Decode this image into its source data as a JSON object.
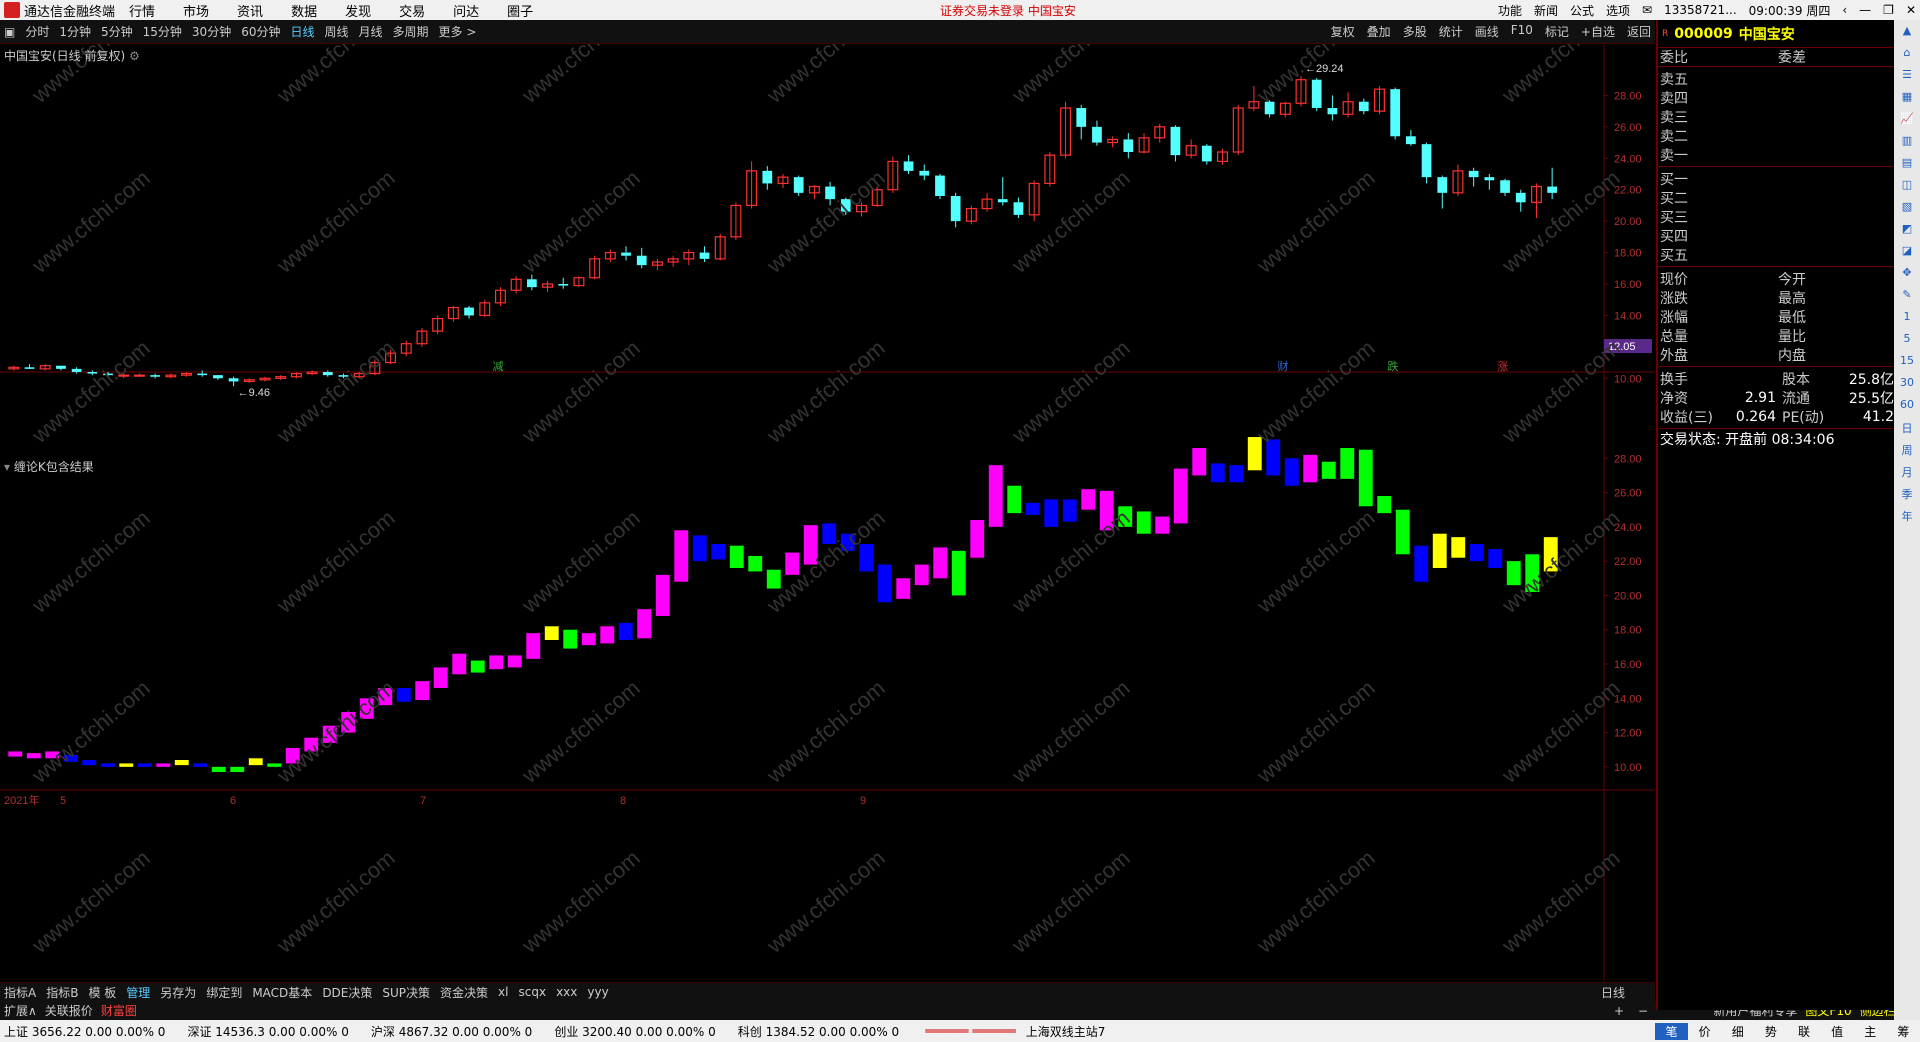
{
  "titlebar": {
    "app": "通达信金融终端",
    "menu": [
      "行情",
      "市场",
      "资讯",
      "数据",
      "发现",
      "交易",
      "问达",
      "圈子"
    ],
    "warning": "证券交易未登录   中国宝安",
    "right": [
      "功能",
      "新闻",
      "公式",
      "选项",
      "13358721...",
      "09:00:39 周四"
    ]
  },
  "periods": [
    "分时",
    "1分钟",
    "5分钟",
    "15分钟",
    "30分钟",
    "60分钟",
    "日线",
    "周线",
    "月线",
    "多周期",
    "更多 >"
  ],
  "active_period": "日线",
  "tools": [
    "复权",
    "叠加",
    "多股",
    "统计",
    "画线",
    "F10",
    "标记",
    "+自选",
    "返回"
  ],
  "chart": {
    "title": "中国宝安(日线 前复权)",
    "sub_title": "缠论K包含结果",
    "price_label": "12.05",
    "max_label": "29.24",
    "min_label": "9.46",
    "date_labels": [
      "2021年",
      "5",
      "6",
      "7",
      "8",
      "9"
    ],
    "flags": [
      {
        "t": "减"
      },
      {
        "t": "财"
      },
      {
        "t": "跌"
      },
      {
        "t": "涨"
      }
    ],
    "watermark": "www.cfchi.com"
  },
  "chart_data": [
    {
      "type": "candlestick",
      "title": "中国宝安(日线 前复权)",
      "ylim": [
        9,
        30
      ],
      "yticks": [
        10,
        12,
        14,
        16,
        18,
        20,
        22,
        24,
        26,
        28
      ],
      "ohlc": [
        [
          10.6,
          10.8,
          10.5,
          10.7
        ],
        [
          10.7,
          10.9,
          10.6,
          10.6
        ],
        [
          10.6,
          10.9,
          10.5,
          10.8
        ],
        [
          10.8,
          10.8,
          10.5,
          10.6
        ],
        [
          10.6,
          10.7,
          10.3,
          10.4
        ],
        [
          10.4,
          10.5,
          10.2,
          10.3
        ],
        [
          10.3,
          10.4,
          10.1,
          10.2
        ],
        [
          10.2,
          10.3,
          10.0,
          10.2
        ],
        [
          10.2,
          10.3,
          10.1,
          10.2
        ],
        [
          10.2,
          10.3,
          10.0,
          10.1
        ],
        [
          10.1,
          10.3,
          10.0,
          10.2
        ],
        [
          10.2,
          10.4,
          10.1,
          10.3
        ],
        [
          10.3,
          10.5,
          10.1,
          10.2
        ],
        [
          10.2,
          10.2,
          9.9,
          10.0
        ],
        [
          10.0,
          10.1,
          9.5,
          9.8
        ],
        [
          9.8,
          10.0,
          9.7,
          9.9
        ],
        [
          9.9,
          10.1,
          9.8,
          10.0
        ],
        [
          10.0,
          10.2,
          9.9,
          10.1
        ],
        [
          10.1,
          10.4,
          10.0,
          10.3
        ],
        [
          10.3,
          10.5,
          10.2,
          10.4
        ],
        [
          10.4,
          10.5,
          10.1,
          10.2
        ],
        [
          10.2,
          10.3,
          10.0,
          10.1
        ],
        [
          10.1,
          10.4,
          10.0,
          10.3
        ],
        [
          10.3,
          11.2,
          10.2,
          11.0
        ],
        [
          11.0,
          11.8,
          10.9,
          11.6
        ],
        [
          11.6,
          12.4,
          11.4,
          12.2
        ],
        [
          12.2,
          13.2,
          12.0,
          13.0
        ],
        [
          13.0,
          14.0,
          12.8,
          13.8
        ],
        [
          13.8,
          14.6,
          13.6,
          14.5
        ],
        [
          14.5,
          14.6,
          13.8,
          14.0
        ],
        [
          14.0,
          15.0,
          13.9,
          14.8
        ],
        [
          14.8,
          15.8,
          14.6,
          15.6
        ],
        [
          15.6,
          16.5,
          15.4,
          16.3
        ],
        [
          16.3,
          16.6,
          15.6,
          15.8
        ],
        [
          15.8,
          16.2,
          15.5,
          16.0
        ],
        [
          16.0,
          16.4,
          15.7,
          15.9
        ],
        [
          15.9,
          16.5,
          15.8,
          16.4
        ],
        [
          16.4,
          17.8,
          16.3,
          17.6
        ],
        [
          17.6,
          18.2,
          17.4,
          18.0
        ],
        [
          18.0,
          18.4,
          17.5,
          17.8
        ],
        [
          17.8,
          18.3,
          17.0,
          17.2
        ],
        [
          17.2,
          17.6,
          16.9,
          17.4
        ],
        [
          17.4,
          17.8,
          17.1,
          17.6
        ],
        [
          17.6,
          18.2,
          17.2,
          18.0
        ],
        [
          18.0,
          18.4,
          17.4,
          17.6
        ],
        [
          17.6,
          19.2,
          17.5,
          19.0
        ],
        [
          19.0,
          21.2,
          18.8,
          21.0
        ],
        [
          21.0,
          23.8,
          20.8,
          23.2
        ],
        [
          23.2,
          23.5,
          22.0,
          22.4
        ],
        [
          22.4,
          23.0,
          22.1,
          22.8
        ],
        [
          22.8,
          22.9,
          21.6,
          21.8
        ],
        [
          21.8,
          22.3,
          21.4,
          22.2
        ],
        [
          22.2,
          22.5,
          21.0,
          21.4
        ],
        [
          21.4,
          21.5,
          20.4,
          20.6
        ],
        [
          20.6,
          21.2,
          20.3,
          21.0
        ],
        [
          21.0,
          22.2,
          20.9,
          22.0
        ],
        [
          22.0,
          24.1,
          21.8,
          23.8
        ],
        [
          23.8,
          24.2,
          23.0,
          23.2
        ],
        [
          23.2,
          23.6,
          22.6,
          22.9
        ],
        [
          22.9,
          23.0,
          21.4,
          21.6
        ],
        [
          21.6,
          21.8,
          19.6,
          20.0
        ],
        [
          20.0,
          21.0,
          19.8,
          20.8
        ],
        [
          20.8,
          21.8,
          20.6,
          21.4
        ],
        [
          21.4,
          22.8,
          21.0,
          21.2
        ],
        [
          21.2,
          21.5,
          20.2,
          20.4
        ],
        [
          20.4,
          22.6,
          20.0,
          22.4
        ],
        [
          22.4,
          24.4,
          22.2,
          24.2
        ],
        [
          24.2,
          27.6,
          24.0,
          27.2
        ],
        [
          27.2,
          27.4,
          25.2,
          26.0
        ],
        [
          26.0,
          26.4,
          24.8,
          25.0
        ],
        [
          25.0,
          25.4,
          24.7,
          25.2
        ],
        [
          25.2,
          25.6,
          24.0,
          24.4
        ],
        [
          24.4,
          25.6,
          24.3,
          25.3
        ],
        [
          25.3,
          26.2,
          25.0,
          26.0
        ],
        [
          26.0,
          26.1,
          23.8,
          24.2
        ],
        [
          24.2,
          25.2,
          24.0,
          24.8
        ],
        [
          24.8,
          24.9,
          23.6,
          23.8
        ],
        [
          23.8,
          24.6,
          23.6,
          24.4
        ],
        [
          24.4,
          27.4,
          24.2,
          27.2
        ],
        [
          27.2,
          28.6,
          27.0,
          27.6
        ],
        [
          27.6,
          27.7,
          26.6,
          26.8
        ],
        [
          26.8,
          27.6,
          26.6,
          27.5
        ],
        [
          27.5,
          29.24,
          27.3,
          29.0
        ],
        [
          29.0,
          29.1,
          27.0,
          27.2
        ],
        [
          27.2,
          28.0,
          26.4,
          26.8
        ],
        [
          26.8,
          28.2,
          26.6,
          27.6
        ],
        [
          27.6,
          27.8,
          26.8,
          27.0
        ],
        [
          27.0,
          28.6,
          26.8,
          28.4
        ],
        [
          28.4,
          28.5,
          25.2,
          25.4
        ],
        [
          25.4,
          25.8,
          24.8,
          24.9
        ],
        [
          24.9,
          25.0,
          22.4,
          22.8
        ],
        [
          22.8,
          22.9,
          20.8,
          21.8
        ],
        [
          21.8,
          23.6,
          21.6,
          23.2
        ],
        [
          23.2,
          23.4,
          22.2,
          22.8
        ],
        [
          22.8,
          23.0,
          22.0,
          22.6
        ],
        [
          22.6,
          22.7,
          21.6,
          21.8
        ],
        [
          21.8,
          22.0,
          20.6,
          21.2
        ],
        [
          21.2,
          22.4,
          20.2,
          22.2
        ],
        [
          22.2,
          23.4,
          21.4,
          21.8
        ]
      ]
    },
    {
      "type": "bar",
      "title": "缠论K包含结果",
      "note": "merged K (包含关系) bars",
      "ylim": [
        9,
        30
      ],
      "bars": [
        [
          10.6,
          10.9,
          "m"
        ],
        [
          10.5,
          10.8,
          "m"
        ],
        [
          10.5,
          10.9,
          "m"
        ],
        [
          10.3,
          10.7,
          "b"
        ],
        [
          10.1,
          10.4,
          "b"
        ],
        [
          10.0,
          10.2,
          "b"
        ],
        [
          10.0,
          10.2,
          "y"
        ],
        [
          10.0,
          10.2,
          "b"
        ],
        [
          10.0,
          10.2,
          "m"
        ],
        [
          10.1,
          10.4,
          "y"
        ],
        [
          10.0,
          10.2,
          "b"
        ],
        [
          9.7,
          10.0,
          "g"
        ],
        [
          9.7,
          10.0,
          "g"
        ],
        [
          10.1,
          10.5,
          "y"
        ],
        [
          10.0,
          10.2,
          "g"
        ],
        [
          10.2,
          11.1,
          "m"
        ],
        [
          10.9,
          11.7,
          "m"
        ],
        [
          11.4,
          12.4,
          "m"
        ],
        [
          12.0,
          13.2,
          "m"
        ],
        [
          12.8,
          14.0,
          "m"
        ],
        [
          13.6,
          14.6,
          "m"
        ],
        [
          13.8,
          14.6,
          "b"
        ],
        [
          13.9,
          15.0,
          "m"
        ],
        [
          14.6,
          15.8,
          "m"
        ],
        [
          15.4,
          16.6,
          "m"
        ],
        [
          15.5,
          16.2,
          "g"
        ],
        [
          15.7,
          16.5,
          "m"
        ],
        [
          15.8,
          16.5,
          "m"
        ],
        [
          16.3,
          17.8,
          "m"
        ],
        [
          17.4,
          18.2,
          "y"
        ],
        [
          16.9,
          18.0,
          "g"
        ],
        [
          17.1,
          17.8,
          "m"
        ],
        [
          17.2,
          18.2,
          "m"
        ],
        [
          17.4,
          18.4,
          "b"
        ],
        [
          17.5,
          19.2,
          "m"
        ],
        [
          18.8,
          21.2,
          "m"
        ],
        [
          20.8,
          23.8,
          "m"
        ],
        [
          22.0,
          23.5,
          "b"
        ],
        [
          22.1,
          23.0,
          "b"
        ],
        [
          21.6,
          22.9,
          "g"
        ],
        [
          21.4,
          22.3,
          "g"
        ],
        [
          20.4,
          21.5,
          "g"
        ],
        [
          21.2,
          22.5,
          "m"
        ],
        [
          21.8,
          24.1,
          "m"
        ],
        [
          23.0,
          24.2,
          "b"
        ],
        [
          22.6,
          23.6,
          "b"
        ],
        [
          21.4,
          23.0,
          "b"
        ],
        [
          19.6,
          21.8,
          "b"
        ],
        [
          19.8,
          21.0,
          "m"
        ],
        [
          20.6,
          21.8,
          "m"
        ],
        [
          21.0,
          22.8,
          "m"
        ],
        [
          20.0,
          22.6,
          "g"
        ],
        [
          22.2,
          24.4,
          "m"
        ],
        [
          24.0,
          27.6,
          "m"
        ],
        [
          24.8,
          26.4,
          "g"
        ],
        [
          24.7,
          25.4,
          "b"
        ],
        [
          24.0,
          25.6,
          "b"
        ],
        [
          24.3,
          25.6,
          "b"
        ],
        [
          25.0,
          26.2,
          "m"
        ],
        [
          23.8,
          26.1,
          "m"
        ],
        [
          24.0,
          25.2,
          "g"
        ],
        [
          23.6,
          24.9,
          "g"
        ],
        [
          23.6,
          24.6,
          "m"
        ],
        [
          24.2,
          27.4,
          "m"
        ],
        [
          27.0,
          28.6,
          "m"
        ],
        [
          26.6,
          27.7,
          "b"
        ],
        [
          26.6,
          27.6,
          "b"
        ],
        [
          27.3,
          29.24,
          "y"
        ],
        [
          27.0,
          29.1,
          "b"
        ],
        [
          26.4,
          28.0,
          "b"
        ],
        [
          26.6,
          28.2,
          "m"
        ],
        [
          26.8,
          27.8,
          "g"
        ],
        [
          26.8,
          28.6,
          "g"
        ],
        [
          25.2,
          28.5,
          "g"
        ],
        [
          24.8,
          25.8,
          "g"
        ],
        [
          22.4,
          25.0,
          "g"
        ],
        [
          20.8,
          22.9,
          "b"
        ],
        [
          21.6,
          23.6,
          "y"
        ],
        [
          22.2,
          23.4,
          "y"
        ],
        [
          22.0,
          23.0,
          "b"
        ],
        [
          21.6,
          22.7,
          "b"
        ],
        [
          20.6,
          22.0,
          "g"
        ],
        [
          20.2,
          22.4,
          "g"
        ],
        [
          21.4,
          23.4,
          "y"
        ]
      ]
    }
  ],
  "side": {
    "code": "000009",
    "name": "中国宝安",
    "head": [
      "委比",
      "委差"
    ],
    "sell": [
      "卖五",
      "卖四",
      "卖三",
      "卖二",
      "卖一"
    ],
    "buy": [
      "买一",
      "买二",
      "买三",
      "买四",
      "买五"
    ],
    "quote": [
      [
        "现价",
        "今开"
      ],
      [
        "涨跌",
        "最高"
      ],
      [
        "涨幅",
        "最低"
      ],
      [
        "总量",
        "量比"
      ],
      [
        "外盘",
        "内盘"
      ]
    ],
    "stats": [
      [
        "换手",
        "",
        "股本",
        "25.8亿"
      ],
      [
        "净资",
        "2.91",
        "流通",
        "25.5亿"
      ],
      [
        "收益(三)",
        "0.264",
        "PE(动)",
        "41.2"
      ]
    ],
    "status": "交易状态: 开盘前 08:34:06"
  },
  "bottomtabs": [
    "指标A",
    "指标B",
    "模 板",
    "管理",
    "另存为",
    "绑定到",
    "MACD基本",
    "DDE决策",
    "SUP决策",
    "资金决策",
    "xl",
    "scqx",
    "xxx",
    "yyy"
  ],
  "bottomtabs_active": "管理",
  "bottomtabs2": [
    "扩展∧",
    "关联报价",
    "财富圈"
  ],
  "right_bottom": [
    "新用户福利专享",
    "图文F10",
    "侧边栏 ≪"
  ],
  "daily_label": "日线",
  "status": [
    [
      "上证",
      "3656.22",
      "0.00",
      "0.00%",
      "0"
    ],
    [
      "深证",
      "14536.3",
      "0.00",
      "0.00%",
      "0"
    ],
    [
      "沪深",
      "4867.32",
      "0.00",
      "0.00%",
      "0"
    ],
    [
      "创业",
      "3200.40",
      "0.00",
      "0.00%",
      "0"
    ],
    [
      "科创",
      "1384.52",
      "0.00",
      "0.00%",
      "0"
    ]
  ],
  "status_site": "上海双线主站7",
  "nav": [
    "笔",
    "价",
    "细",
    "势",
    "联",
    "值",
    "主",
    "筹"
  ],
  "colors": {
    "up": "#ff3232",
    "down": "#54ffff",
    "bg": "#000000",
    "magenta": "#ff00ff",
    "blue": "#0000ff",
    "yellow": "#ffff00",
    "green": "#00ff00",
    "grid": "#6a0000"
  }
}
